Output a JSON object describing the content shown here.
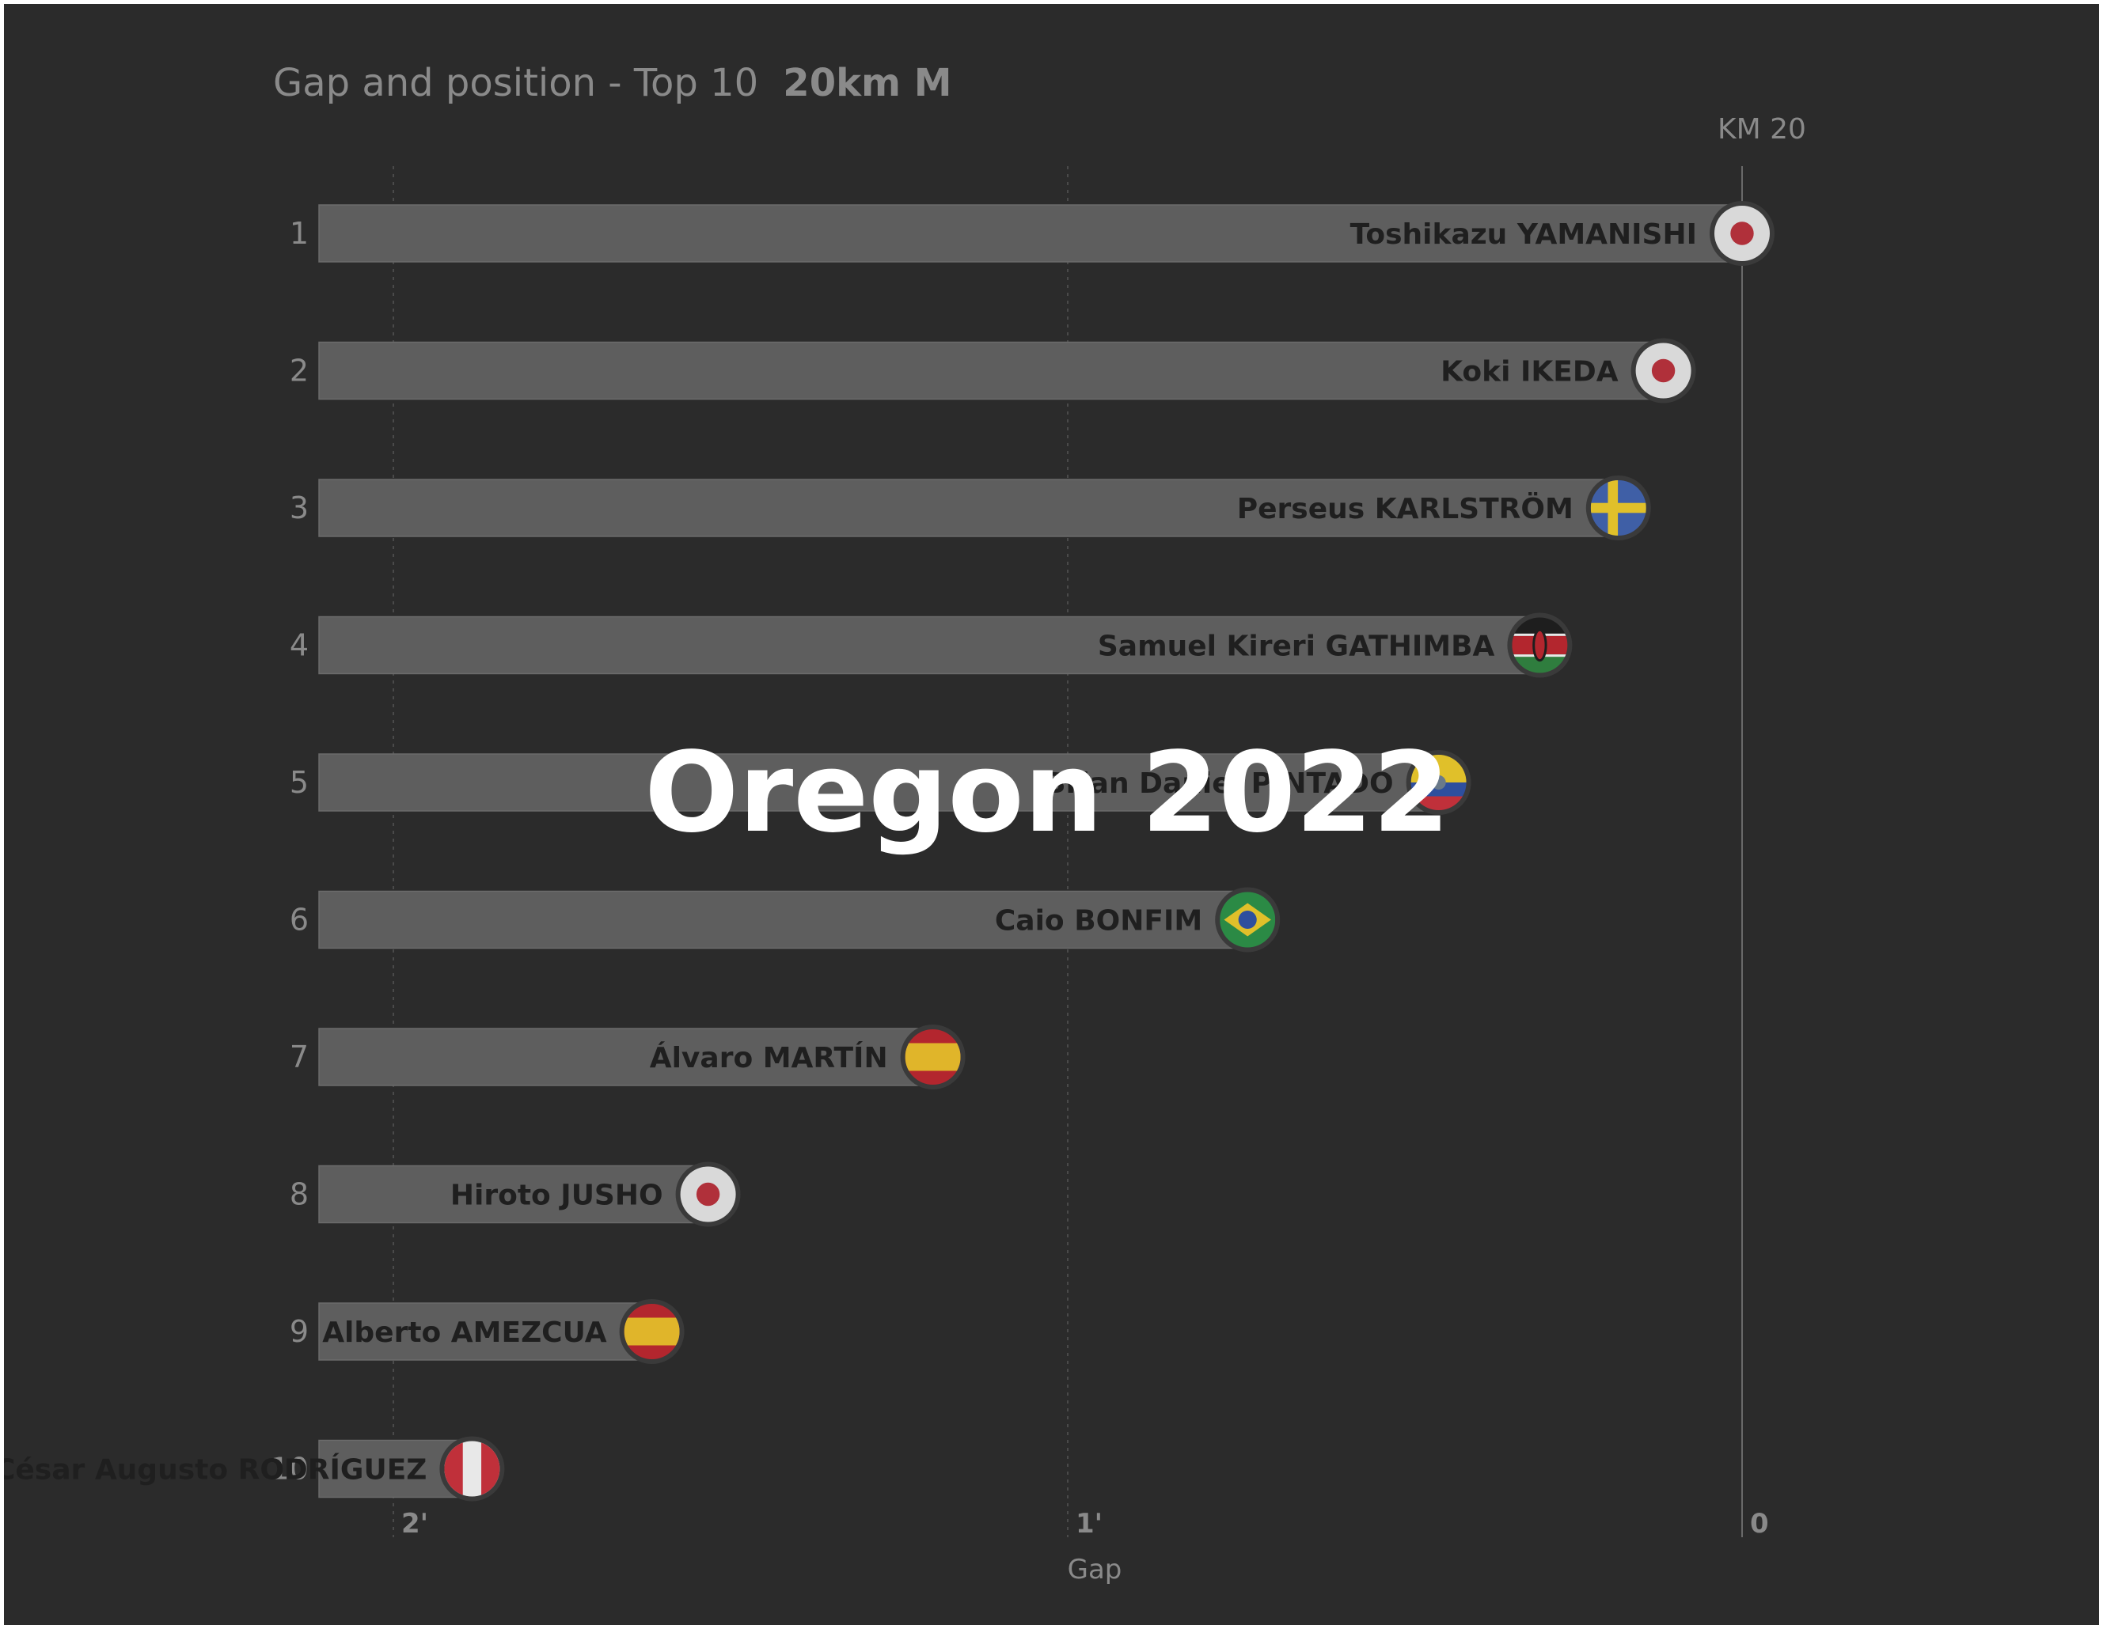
{
  "chart_data": {
    "type": "bar",
    "title": "Gap and position - Top 10",
    "subtitle": "20km M",
    "xlabel": "Gap",
    "checkpoint": "KM 20",
    "watermark": "Oregon 2022",
    "x_axis_reversed": true,
    "xlim_seconds": [
      0,
      135
    ],
    "x_ticks": [
      {
        "value": 120,
        "label": "2'"
      },
      {
        "value": 60,
        "label": "1'"
      },
      {
        "value": 0,
        "label": "0"
      }
    ],
    "grid": true,
    "categories": [
      "1",
      "2",
      "3",
      "4",
      "5",
      "6",
      "7",
      "8",
      "9",
      "10"
    ],
    "athletes": [
      {
        "rank": "1",
        "name": "Toshikazu YAMANISHI",
        "gap_seconds": 0,
        "flag": "japan-flag"
      },
      {
        "rank": "2",
        "name": "Koki IKEDA",
        "gap_seconds": 7,
        "flag": "japan-flag"
      },
      {
        "rank": "3",
        "name": "Perseus KARLSTRÖM",
        "gap_seconds": 11,
        "flag": "sweden-flag"
      },
      {
        "rank": "4",
        "name": "Samuel Kireri GATHIMBA",
        "gap_seconds": 18,
        "flag": "kenya-flag"
      },
      {
        "rank": "5",
        "name": "Brian Daniel PINTADO",
        "gap_seconds": 27,
        "flag": "ecuador-flag"
      },
      {
        "rank": "6",
        "name": "Caio BONFIM",
        "gap_seconds": 44,
        "flag": "brazil-flag"
      },
      {
        "rank": "7",
        "name": "Álvaro MARTÍN",
        "gap_seconds": 72,
        "flag": "spain-flag"
      },
      {
        "rank": "8",
        "name": "Hiroto JUSHO",
        "gap_seconds": 92,
        "flag": "japan-flag"
      },
      {
        "rank": "9",
        "name": "Alberto AMEZCUA",
        "gap_seconds": 97,
        "flag": "spain-flag"
      },
      {
        "rank": "10",
        "name": "César Augusto RODRÍGUEZ",
        "gap_seconds": 113,
        "flag": "peru-flag"
      }
    ],
    "colors": {
      "background": "#2b2b2b",
      "bar": "#5e5e5e",
      "bar_edge": "#6b6b6b",
      "text_muted": "#8a8a8a",
      "text_dark": "#1f1f1f",
      "grid": "#555555"
    }
  }
}
